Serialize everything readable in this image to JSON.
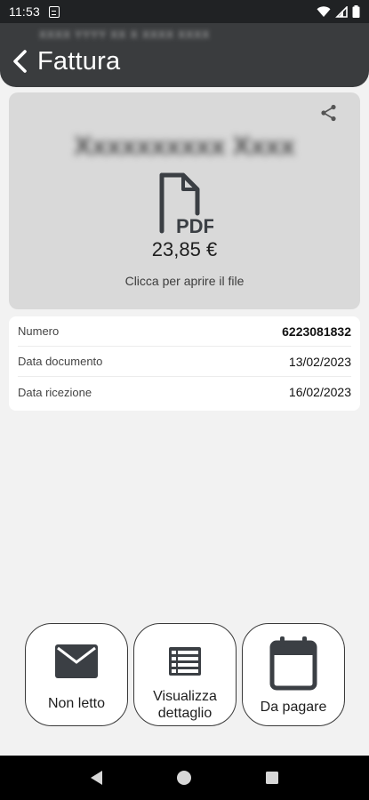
{
  "status_bar": {
    "time": "11:53",
    "icons": [
      "sim-icon",
      "wifi-icon",
      "signal-icon",
      "battery-icon"
    ]
  },
  "header": {
    "subtitle": "XXXX YYYY XX X XXXX XXXX",
    "title": "Fattura",
    "back_icon": "chevron-left-icon"
  },
  "document": {
    "company": "Xxxxxxxxxx Xxxx",
    "file_type": "PDF",
    "amount": "23,85 €",
    "hint": "Clicca per aprire il file",
    "share_icon": "share-icon"
  },
  "details": [
    {
      "label": "Numero",
      "value": "6223081832"
    },
    {
      "label": "Data documento",
      "value": "13/02/2023"
    },
    {
      "label": "Data ricezione",
      "value": "16/02/2023"
    }
  ],
  "actions": [
    {
      "label": "Non letto",
      "icon": "envelope-icon"
    },
    {
      "label": "Visualizza dettaglio",
      "icon": "list-icon"
    },
    {
      "label": "Da pagare",
      "icon": "calendar-icon"
    }
  ],
  "colors": {
    "header_bg": "#3a3c3e",
    "status_bg": "#202224",
    "page_bg": "#f2f2f2",
    "card_bg": "#d9d9d9",
    "icon_dark": "#3b3f44"
  }
}
